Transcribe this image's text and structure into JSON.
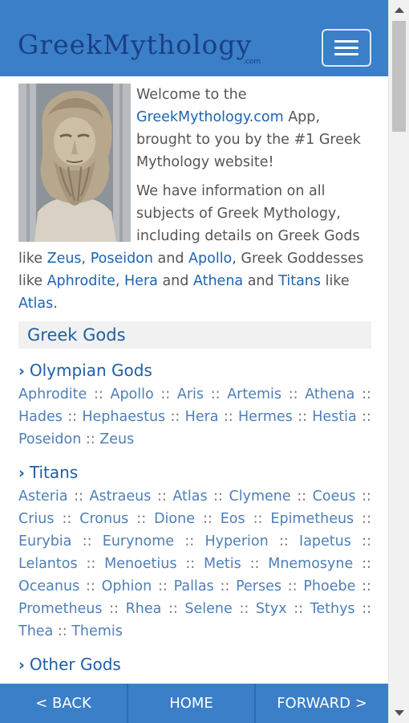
{
  "header": {
    "logo_text": "GreekMythology",
    "logo_dotcom": ".com",
    "menu_icon": "hamburger-menu-icon"
  },
  "intro": {
    "welcome_pre": "Welcome to the ",
    "site_link": "GreekMythology.com",
    "welcome_post": " App, brought to you by the #1 Greek Mythology website!",
    "info_pre": "We have information on all subjects of Greek Mythology, including details on Greek Gods like ",
    "gods": [
      "Zeus",
      "Poseidon",
      "Apollo"
    ],
    "goddesses_pre": ", Greek Goddesses like ",
    "goddesses": [
      "Aphrodite",
      "Hera",
      "Athena"
    ],
    "titans_pre": " and ",
    "titans_word_link": "Titans",
    "titans_like": " like ",
    "titan_example": "Atlas",
    "period": ".",
    "comma": ", ",
    "and": " and ",
    "image_icon": "zeus-bust-image"
  },
  "sections": {
    "greek_gods_title": "Greek Gods",
    "olympian_title": "Olympian Gods",
    "olympians": [
      "Aphrodite",
      "Apollo",
      "Aris",
      "Artemis",
      "Athena",
      "Hades",
      "Hephaestus",
      "Hera",
      "Hermes",
      "Hestia",
      "Poseidon",
      "Zeus"
    ],
    "titans_title": "Titans",
    "titans": [
      "Asteria",
      "Astraeus",
      "Atlas",
      "Clymene",
      "Coeus",
      "Crius",
      "Cronus",
      "Dione",
      "Eos",
      "Epimetheus",
      "Eurybia",
      "Eurynome",
      "Hyperion",
      "Iapetus",
      "Lelantos",
      "Menoetius",
      "Metis",
      "Mnemosyne",
      "Oceanus",
      "Ophion",
      "Pallas",
      "Perses",
      "Phoebe",
      "Prometheus",
      "Rhea",
      "Selene",
      "Styx",
      "Tethys",
      "Thea",
      "Themis"
    ],
    "other_title": "Other Gods",
    "separator": "::",
    "chevron_icon": "chevron-right-icon"
  },
  "footer": {
    "back": "< BACK",
    "home": "HOME",
    "forward": "FORWARD >"
  },
  "colors": {
    "header_bg": "#3a7fc8",
    "logo": "#1b3f86",
    "link": "#1d64b0",
    "list_link": "#4e7fb6",
    "section_bar": "#f1f1f1"
  }
}
